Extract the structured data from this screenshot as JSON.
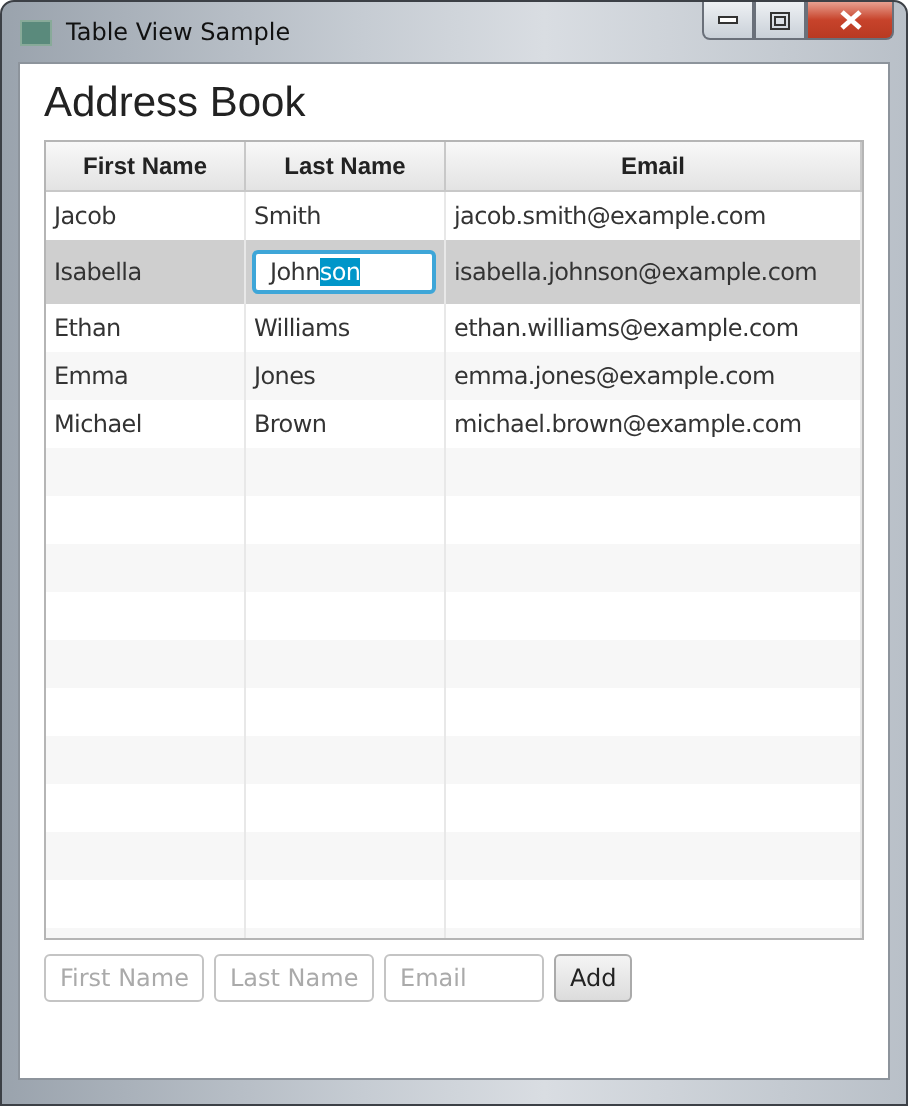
{
  "window": {
    "title": "Table View Sample"
  },
  "heading": "Address Book",
  "table": {
    "columns": [
      "First Name",
      "Last Name",
      "Email"
    ],
    "rows": [
      {
        "first": "Jacob",
        "last": "Smith",
        "email": "jacob.smith@example.com",
        "selected": false
      },
      {
        "first": "Isabella",
        "email": "isabella.johnson@example.com",
        "selected": true,
        "editing": {
          "unselected_text": "John",
          "selected_text": "son"
        }
      },
      {
        "first": "Ethan",
        "last": "Williams",
        "email": "ethan.williams@example.com",
        "selected": false
      },
      {
        "first": "Emma",
        "last": "Jones",
        "email": "emma.jones@example.com",
        "selected": false
      },
      {
        "first": "Michael",
        "last": "Brown",
        "email": "michael.brown@example.com",
        "selected": false
      }
    ]
  },
  "form": {
    "fields": [
      {
        "placeholder": "First Name"
      },
      {
        "placeholder": "Last Name"
      },
      {
        "placeholder": "Email"
      }
    ],
    "button": "Add"
  }
}
